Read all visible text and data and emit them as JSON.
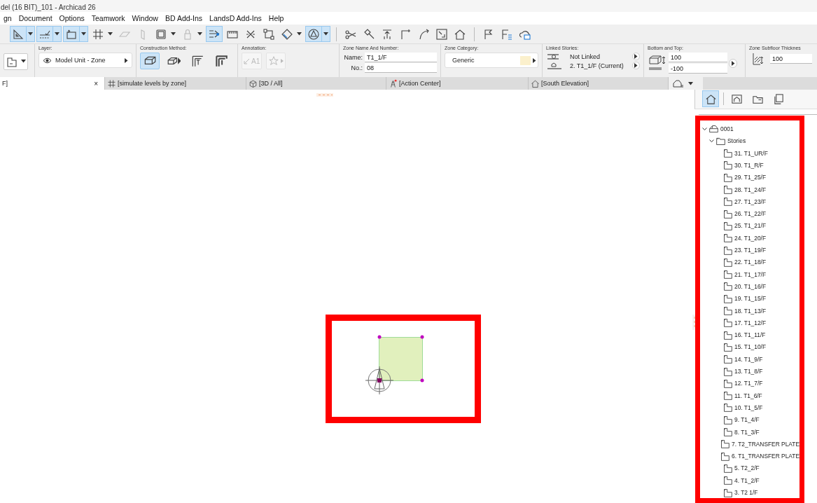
{
  "window": {
    "title": "del (16 BIT)_101 - Archicad 26"
  },
  "menu": [
    "gn",
    "Document",
    "Options",
    "Teamwork",
    "Window",
    "BD Add-Ins",
    "LandsD Add-Ins",
    "Help"
  ],
  "toolbar": [
    {
      "kind": "triangle-ruler",
      "selected": true,
      "disabled": false,
      "dropdown": true
    },
    {
      "kind": "line-tick",
      "selected": true,
      "disabled": false,
      "dropdown": true
    },
    {
      "kind": "label-box",
      "selected": true,
      "disabled": false,
      "dropdown": true
    },
    {
      "kind": "grid",
      "selected": false,
      "disabled": false,
      "dropdown": true
    },
    {
      "kind": "plane",
      "selected": false,
      "disabled": true,
      "dropdown": false
    },
    {
      "kind": "panel",
      "selected": false,
      "disabled": true,
      "dropdown": false
    },
    {
      "kind": "square",
      "selected": false,
      "disabled": false,
      "dropdown": true
    },
    {
      "kind": "lock",
      "selected": false,
      "disabled": true,
      "dropdown": true
    },
    {
      "kind": "snap",
      "selected": true,
      "disabled": false,
      "dropdown": false
    },
    {
      "kind": "ruler",
      "selected": false,
      "disabled": false,
      "dropdown": false
    },
    {
      "kind": "cross",
      "selected": false,
      "disabled": false,
      "dropdown": false
    },
    {
      "kind": "nodes",
      "selected": false,
      "disabled": false,
      "dropdown": false
    },
    {
      "kind": "diamond",
      "selected": false,
      "disabled": false,
      "dropdown": true
    },
    {
      "kind": "circle-triangle",
      "selected": true,
      "disabled": false,
      "dropdown": true
    },
    {
      "kind": "separator"
    },
    {
      "kind": "scissors",
      "selected": false,
      "disabled": false,
      "dropdown": false
    },
    {
      "kind": "hammer",
      "selected": false,
      "disabled": false,
      "dropdown": false
    },
    {
      "kind": "arrow-up",
      "selected": false,
      "disabled": false,
      "dropdown": false
    },
    {
      "kind": "corner",
      "selected": false,
      "disabled": false,
      "dropdown": false
    },
    {
      "kind": "curve",
      "selected": false,
      "disabled": false,
      "dropdown": false
    },
    {
      "kind": "resize-box",
      "selected": false,
      "disabled": false,
      "dropdown": false
    },
    {
      "kind": "house",
      "selected": false,
      "disabled": false,
      "dropdown": false
    },
    {
      "kind": "separator"
    },
    {
      "kind": "flag",
      "selected": false,
      "disabled": false,
      "dropdown": false
    },
    {
      "kind": "flag-list",
      "selected": false,
      "disabled": false,
      "dropdown": false
    },
    {
      "kind": "cloud",
      "selected": false,
      "disabled": false,
      "dropdown": false
    }
  ],
  "info_box": {
    "layer": {
      "label": "Layer:",
      "value": "Model Unit - Zone"
    },
    "construction_method": {
      "label": "Construction Method:",
      "options": [
        {
          "kind": "box",
          "selected": true
        },
        {
          "kind": "box-arrow",
          "selected": false
        },
        {
          "kind": "frame",
          "selected": false
        },
        {
          "kind": "frame-bold",
          "selected": false
        }
      ]
    },
    "annotation": {
      "label": "Annotation:",
      "buttons": [
        {
          "kind": "label-arrow",
          "text": "A1",
          "disabled": true
        },
        {
          "kind": "star",
          "disabled": true
        }
      ]
    },
    "zone_name": {
      "label": "Zone Name And Number:",
      "name_label": "Name:",
      "name": "T1_1/F",
      "number_label": "No.:",
      "number": "08"
    },
    "zone_category": {
      "label": "Zone Category:",
      "value": "Generic",
      "color": "#fbf0cc"
    },
    "linked_stories": {
      "label": "Linked Stories:",
      "rows": [
        "Not Linked",
        "2. T1_1/F (Current)"
      ]
    },
    "bottom_top": {
      "label": "Bottom and Top:",
      "values": [
        "100",
        "-100"
      ]
    },
    "subfloor": {
      "label": "Zone Subfloor Thicknes",
      "value": "100"
    }
  },
  "tabs": [
    {
      "label": "F]",
      "selected": true,
      "close": "×"
    },
    {
      "kind": "grid",
      "label": "[simulate levels by zone]",
      "selected": false
    },
    {
      "kind": "cube",
      "label": "[3D / All]",
      "selected": false
    },
    {
      "kind": "tower",
      "label": "[Action Center]",
      "selected": false
    },
    {
      "kind": "house",
      "label": "[South Elevation]",
      "selected": false
    }
  ],
  "navigator": {
    "tools": [
      {
        "kind": "house",
        "selected": true
      },
      {
        "kind": "house-frame",
        "selected": false
      },
      {
        "kind": "folder-plan",
        "selected": false
      },
      {
        "kind": "stack",
        "selected": false
      }
    ],
    "tree": [
      {
        "label": "0001",
        "kind": "project",
        "expanded": true,
        "children": [
          {
            "label": "Stories",
            "kind": "folder",
            "expanded": true,
            "children": [
              {
                "label": "31. T1_UR/F",
                "kind": "story"
              },
              {
                "label": "30. T1_R/F",
                "kind": "story"
              },
              {
                "label": "29. T1_25/F",
                "kind": "story"
              },
              {
                "label": "28. T1_24/F",
                "kind": "story"
              },
              {
                "label": "27. T1_23/F",
                "kind": "story"
              },
              {
                "label": "26. T1_22/F",
                "kind": "story"
              },
              {
                "label": "25. T1_21/F",
                "kind": "story"
              },
              {
                "label": "24. T1_20/F",
                "kind": "story"
              },
              {
                "label": "23. T1_19/F",
                "kind": "story"
              },
              {
                "label": "22. T1_18/F",
                "kind": "story"
              },
              {
                "label": "21. T1_17/F",
                "kind": "story"
              },
              {
                "label": "20. T1_16/F",
                "kind": "story"
              },
              {
                "label": "19. T1_15/F",
                "kind": "story"
              },
              {
                "label": "18. T1_13/F",
                "kind": "story"
              },
              {
                "label": "17. T1_12/F",
                "kind": "story"
              },
              {
                "label": "16. T1_11/F",
                "kind": "story"
              },
              {
                "label": "15. T1_10/F",
                "kind": "story"
              },
              {
                "label": "14. T1_9/F",
                "kind": "story"
              },
              {
                "label": "13. T1_8/F",
                "kind": "story"
              },
              {
                "label": "12. T1_7/F",
                "kind": "story"
              },
              {
                "label": "11. T1_6/F",
                "kind": "story"
              },
              {
                "label": "10. T1_5/F",
                "kind": "story"
              },
              {
                "label": "9. T1_4/F",
                "kind": "story"
              },
              {
                "label": "8. T1_3/F",
                "kind": "story"
              },
              {
                "label": "7. T2_TRANSFER PLATE",
                "kind": "story"
              },
              {
                "label": "6. T1_TRANSFER PLATE",
                "kind": "story"
              },
              {
                "label": "5. T2_2/F",
                "kind": "story"
              },
              {
                "label": "4. T1_2/F",
                "kind": "story"
              },
              {
                "label": "3. T2 1/F",
                "kind": "story"
              }
            ]
          }
        ]
      }
    ]
  }
}
